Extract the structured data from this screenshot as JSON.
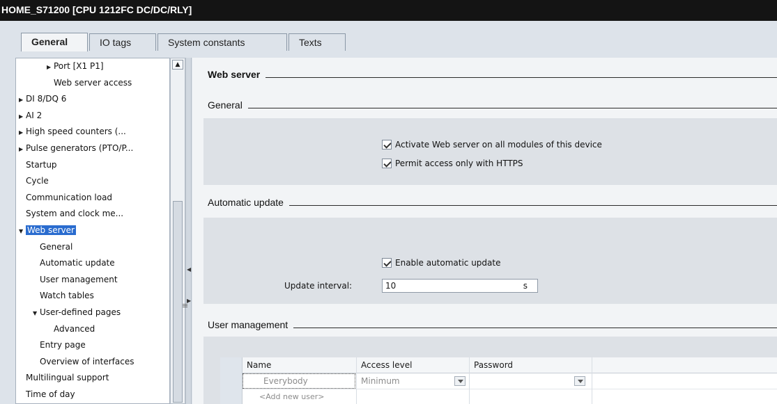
{
  "window": {
    "title": "HOME_S71200 [CPU 1212FC DC/DC/RLY]"
  },
  "tabs": [
    {
      "label": "General",
      "active": true
    },
    {
      "label": "IO tags",
      "active": false
    },
    {
      "label": "System constants",
      "active": false
    },
    {
      "label": "Texts",
      "active": false
    }
  ],
  "nav": {
    "items": [
      {
        "label": "Port [X1 P1]",
        "level": 2,
        "arrow": "right"
      },
      {
        "label": "Web server access",
        "level": 2,
        "arrow": ""
      },
      {
        "label": "DI 8/DQ 6",
        "level": 0,
        "arrow": "right"
      },
      {
        "label": "AI 2",
        "level": 0,
        "arrow": "right"
      },
      {
        "label": "High speed counters (...",
        "level": 0,
        "arrow": "right"
      },
      {
        "label": "Pulse generators (PTO/P...",
        "level": 0,
        "arrow": "right"
      },
      {
        "label": "Startup",
        "level": 0,
        "arrow": ""
      },
      {
        "label": "Cycle",
        "level": 0,
        "arrow": ""
      },
      {
        "label": "Communication load",
        "level": 0,
        "arrow": ""
      },
      {
        "label": "System and clock me...",
        "level": 0,
        "arrow": ""
      },
      {
        "label": "Web server",
        "level": 0,
        "arrow": "down",
        "selected": true
      },
      {
        "label": "General",
        "level": 1,
        "arrow": ""
      },
      {
        "label": "Automatic update",
        "level": 1,
        "arrow": ""
      },
      {
        "label": "User management",
        "level": 1,
        "arrow": ""
      },
      {
        "label": "Watch tables",
        "level": 1,
        "arrow": ""
      },
      {
        "label": "User-defined pages",
        "level": 1,
        "arrow": "down"
      },
      {
        "label": "Advanced",
        "level": 2,
        "arrow": ""
      },
      {
        "label": "Entry page",
        "level": 1,
        "arrow": ""
      },
      {
        "label": "Overview of interfaces",
        "level": 1,
        "arrow": ""
      },
      {
        "label": "Multilingual support",
        "level": 0,
        "arrow": ""
      },
      {
        "label": "Time of day",
        "level": 0,
        "arrow": ""
      }
    ]
  },
  "content": {
    "title": "Web server",
    "general": {
      "heading": "General",
      "activate_label": "Activate Web server on all modules of this device",
      "activate_checked": true,
      "https_label": "Permit access only with HTTPS",
      "https_checked": true
    },
    "auto_update": {
      "heading": "Automatic update",
      "enable_label": "Enable automatic update",
      "enable_checked": true,
      "interval_label": "Update interval:",
      "interval_value": "10",
      "interval_unit": "s"
    },
    "user_mgmt": {
      "heading": "User management",
      "columns": [
        "Name",
        "Access level",
        "Password"
      ],
      "rows": [
        {
          "name": "Everybody",
          "access": "Minimum",
          "password": ""
        }
      ],
      "add_row_label": "<Add new user>"
    }
  },
  "colors": {
    "selection": "#2a6ccf",
    "titlebar": "#141414",
    "panel": "#dde1e6"
  }
}
